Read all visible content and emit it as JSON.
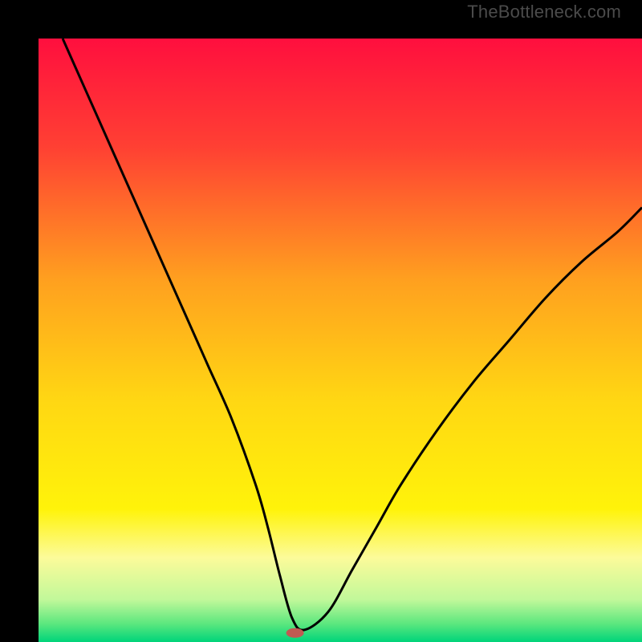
{
  "watermark": "TheBottleneck.com",
  "chart_data": {
    "type": "line",
    "title": "",
    "xlabel": "",
    "ylabel": "",
    "xlim": [
      0,
      100
    ],
    "ylim": [
      0,
      100
    ],
    "background_gradient": {
      "direction": "vertical",
      "stops": [
        {
          "pos": 0.0,
          "color": "#ff0f3e"
        },
        {
          "pos": 0.18,
          "color": "#ff4033"
        },
        {
          "pos": 0.4,
          "color": "#ffa01f"
        },
        {
          "pos": 0.6,
          "color": "#ffd713"
        },
        {
          "pos": 0.78,
          "color": "#fff30a"
        },
        {
          "pos": 0.86,
          "color": "#fcfb9a"
        },
        {
          "pos": 0.93,
          "color": "#c1f89a"
        },
        {
          "pos": 0.97,
          "color": "#5be77e"
        },
        {
          "pos": 1.0,
          "color": "#00d47a"
        }
      ]
    },
    "series": [
      {
        "name": "bottleneck-curve",
        "stroke": "#000000",
        "x": [
          4,
          8,
          12,
          16,
          20,
          24,
          28,
          32,
          36,
          38,
          40,
          42,
          44,
          48,
          52,
          56,
          60,
          66,
          72,
          78,
          84,
          90,
          96,
          100
        ],
        "y": [
          100,
          91,
          82,
          73,
          64,
          55,
          46,
          37,
          26,
          19,
          11,
          4,
          2,
          5,
          12,
          19,
          26,
          35,
          43,
          50,
          57,
          63,
          68,
          72
        ]
      }
    ],
    "marker": {
      "name": "optimal-point",
      "x": 42.5,
      "y": 1.5,
      "color": "#c15a52",
      "rx": 11,
      "ry": 6
    }
  }
}
